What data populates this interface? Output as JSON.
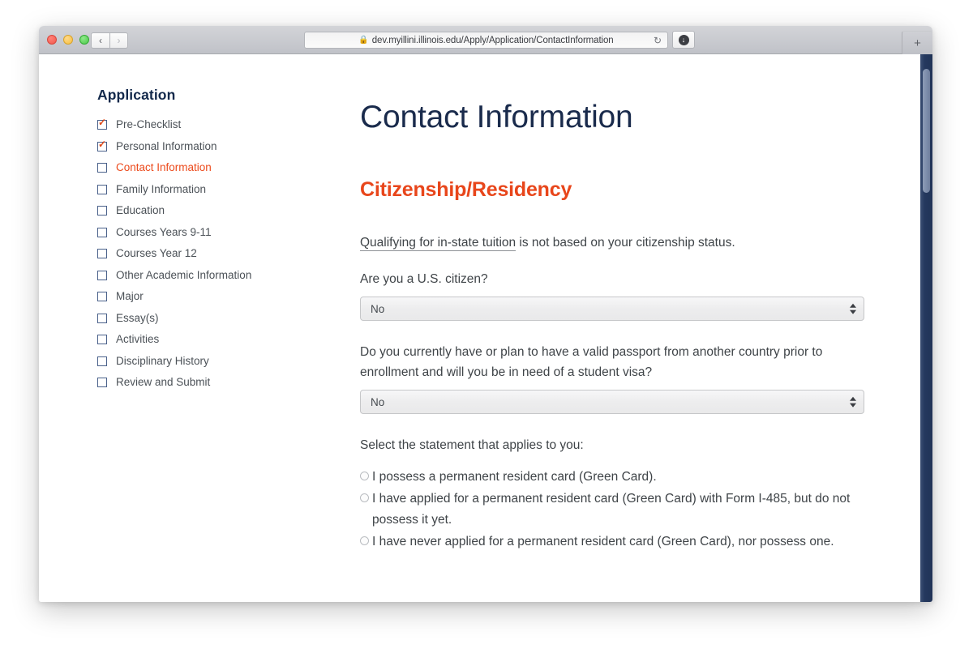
{
  "browser": {
    "url": "dev.myillini.illinois.edu/Apply/Application/ContactInformation",
    "lock_icon": "lock-icon",
    "reload_icon": "reload-icon",
    "back_icon": "‹",
    "forward_icon": "›",
    "download_icon": "↓",
    "new_tab_icon": "+"
  },
  "sidebar": {
    "title": "Application",
    "items": [
      {
        "label": "Pre-Checklist",
        "checked": true,
        "active": false
      },
      {
        "label": "Personal Information",
        "checked": true,
        "active": false
      },
      {
        "label": "Contact Information",
        "checked": false,
        "active": true
      },
      {
        "label": "Family Information",
        "checked": false,
        "active": false
      },
      {
        "label": "Education",
        "checked": false,
        "active": false
      },
      {
        "label": "Courses Years 9-11",
        "checked": false,
        "active": false
      },
      {
        "label": "Courses Year 12",
        "checked": false,
        "active": false
      },
      {
        "label": "Other Academic Information",
        "checked": false,
        "active": false
      },
      {
        "label": "Major",
        "checked": false,
        "active": false
      },
      {
        "label": "Essay(s)",
        "checked": false,
        "active": false
      },
      {
        "label": "Activities",
        "checked": false,
        "active": false
      },
      {
        "label": "Disciplinary History",
        "checked": false,
        "active": false
      },
      {
        "label": "Review and Submit",
        "checked": false,
        "active": false
      }
    ]
  },
  "main": {
    "page_title": "Contact Information",
    "section_title": "Citizenship/Residency",
    "intro_link_text": "Qualifying for in-state tuition",
    "intro_rest_text": " is not based on your citizenship status.",
    "citizen_question": "Are you a U.S. citizen?",
    "citizen_value": "No",
    "passport_question": "Do you currently have or plan to have a valid passport from another country prior to enrollment and will you be in need of a student visa?",
    "passport_value": "No",
    "radio_prompt": "Select the statement that applies to you:",
    "radio_options": [
      {
        "label": "I possess a permanent resident card (Green Card).",
        "selected": false
      },
      {
        "label": "I have applied for a permanent resident card (Green Card) with Form I-485, but do not possess it yet.",
        "selected": false
      },
      {
        "label": "I have never applied for a permanent resident card (Green Card), nor possess one.",
        "selected": false
      }
    ]
  },
  "colors": {
    "brand_navy": "#13294b",
    "brand_orange": "#e8461b",
    "scrollbar_navy": "#213457"
  }
}
